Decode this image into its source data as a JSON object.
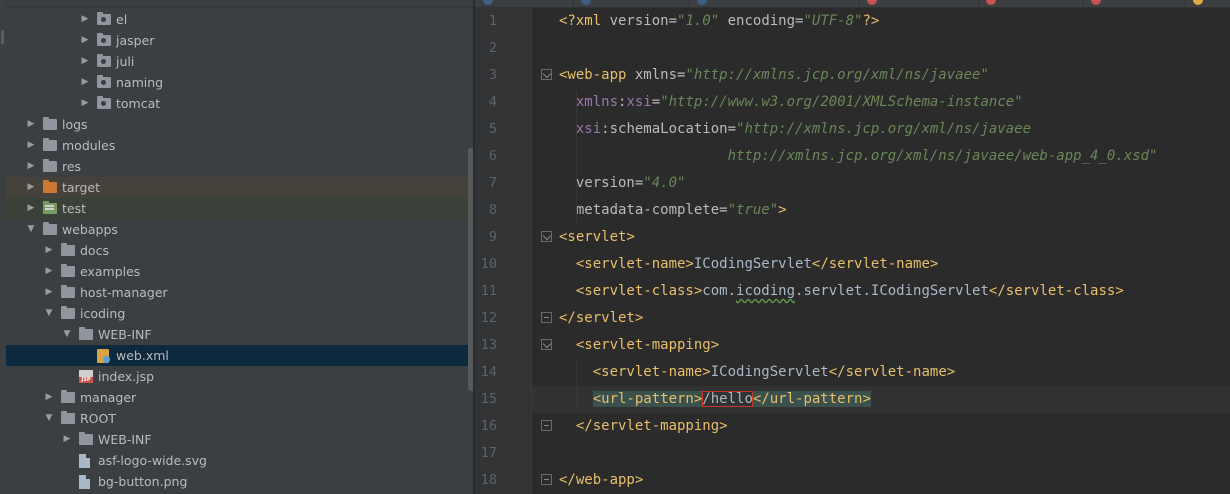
{
  "tree": {
    "items": [
      {
        "label": "el",
        "depth": 4,
        "icon": "package-folder-icon",
        "arrow": "right"
      },
      {
        "label": "jasper",
        "depth": 4,
        "icon": "package-folder-icon",
        "arrow": "right"
      },
      {
        "label": "juli",
        "depth": 4,
        "icon": "package-folder-icon",
        "arrow": "right"
      },
      {
        "label": "naming",
        "depth": 4,
        "icon": "package-folder-icon",
        "arrow": "right"
      },
      {
        "label": "tomcat",
        "depth": 4,
        "icon": "package-folder-icon",
        "arrow": "right"
      },
      {
        "label": "logs",
        "depth": 1,
        "icon": "folder-icon",
        "arrow": "right"
      },
      {
        "label": "modules",
        "depth": 1,
        "icon": "folder-icon",
        "arrow": "right"
      },
      {
        "label": "res",
        "depth": 1,
        "icon": "folder-icon",
        "arrow": "right"
      },
      {
        "label": "target",
        "depth": 1,
        "icon": "excluded-folder-icon",
        "arrow": "right",
        "state": "target"
      },
      {
        "label": "test",
        "depth": 1,
        "icon": "test-folder-icon",
        "arrow": "right",
        "state": "test"
      },
      {
        "label": "webapps",
        "depth": 1,
        "icon": "folder-icon",
        "arrow": "down"
      },
      {
        "label": "docs",
        "depth": 2,
        "icon": "folder-icon",
        "arrow": "right"
      },
      {
        "label": "examples",
        "depth": 2,
        "icon": "folder-icon",
        "arrow": "right"
      },
      {
        "label": "host-manager",
        "depth": 2,
        "icon": "folder-icon",
        "arrow": "right"
      },
      {
        "label": "icoding",
        "depth": 2,
        "icon": "folder-icon",
        "arrow": "down"
      },
      {
        "label": "WEB-INF",
        "depth": 3,
        "icon": "folder-icon",
        "arrow": "down"
      },
      {
        "label": "web.xml",
        "depth": 4,
        "icon": "xml-file-icon",
        "arrow": "none",
        "state": "selected"
      },
      {
        "label": "index.jsp",
        "depth": 3,
        "icon": "jsp-file-icon",
        "arrow": "none"
      },
      {
        "label": "manager",
        "depth": 2,
        "icon": "folder-icon",
        "arrow": "right"
      },
      {
        "label": "ROOT",
        "depth": 2,
        "icon": "folder-icon",
        "arrow": "down"
      },
      {
        "label": "WEB-INF",
        "depth": 3,
        "icon": "folder-icon",
        "arrow": "right"
      },
      {
        "label": "asf-logo-wide.svg",
        "depth": 3,
        "icon": "svg-file-icon",
        "arrow": "none"
      },
      {
        "label": "bg-button.png",
        "depth": 3,
        "icon": "image-file-icon",
        "arrow": "none"
      }
    ]
  },
  "tabs": [
    {
      "dot": "#3d6185"
    },
    {
      "dot": "#3d6185"
    },
    {
      "dot": "#3d6185"
    },
    {
      "dot": "#c75450"
    },
    {
      "dot": "#c75450"
    },
    {
      "dot": "#c75450"
    },
    {
      "dot": "#e0a843"
    }
  ],
  "editor": {
    "current_line": 15,
    "lines": [
      {
        "n": "1",
        "segs": [
          [
            "tg",
            "<?xml "
          ],
          [
            "at",
            "version="
          ],
          [
            "va",
            "\"1.0\""
          ],
          [
            "at",
            " encoding="
          ],
          [
            "va",
            "\"UTF-8\""
          ],
          [
            "tg",
            "?>"
          ]
        ]
      },
      {
        "n": "2",
        "segs": []
      },
      {
        "n": "3",
        "fold": "start",
        "segs": [
          [
            "tg",
            "<web-app "
          ],
          [
            "at",
            "xmlns="
          ],
          [
            "va",
            "\"http://xmlns.jcp.org/xml/ns/javaee\""
          ]
        ]
      },
      {
        "n": "4",
        "segs": [
          [
            "at",
            "  "
          ],
          [
            "ns",
            "xmlns"
          ],
          [
            "at",
            ":"
          ],
          [
            "ns",
            "xsi"
          ],
          [
            "at",
            "="
          ],
          [
            "va",
            "\"http://www.w3.org/2001/XMLSchema-instance\""
          ]
        ]
      },
      {
        "n": "5",
        "segs": [
          [
            "at",
            "  "
          ],
          [
            "ns",
            "xsi"
          ],
          [
            "at",
            ":schemaLocation="
          ],
          [
            "va",
            "\"http://xmlns.jcp.org/xml/ns/javaee"
          ]
        ]
      },
      {
        "n": "6",
        "segs": [
          [
            "va",
            "                    http://xmlns.jcp.org/xml/ns/javaee/web-app_4_0.xsd\""
          ]
        ]
      },
      {
        "n": "7",
        "segs": [
          [
            "at",
            "  version="
          ],
          [
            "va",
            "\"4.0\""
          ]
        ]
      },
      {
        "n": "8",
        "segs": [
          [
            "at",
            "  metadata-complete="
          ],
          [
            "va",
            "\"true\""
          ],
          [
            "tg",
            ">"
          ]
        ]
      },
      {
        "n": "9",
        "fold": "start",
        "segs": [
          [
            "tg",
            "<servlet>"
          ]
        ]
      },
      {
        "n": "10",
        "segs": [
          [
            "at",
            "  "
          ],
          [
            "tg",
            "<servlet-name>"
          ],
          [
            "txt",
            "ICodingServlet"
          ],
          [
            "tg",
            "</servlet-name>"
          ]
        ]
      },
      {
        "n": "11",
        "segs": [
          [
            "at",
            "  "
          ],
          [
            "tg",
            "<servlet-class>"
          ],
          [
            "txt",
            "com."
          ],
          [
            "typo",
            "icoding"
          ],
          [
            "txt",
            ".servlet.ICodingServlet"
          ],
          [
            "tg",
            "</servlet-class>"
          ]
        ]
      },
      {
        "n": "12",
        "fold": "end",
        "segs": [
          [
            "tg",
            "</servlet>"
          ]
        ]
      },
      {
        "n": "13",
        "fold": "start",
        "segs": [
          [
            "at",
            "  "
          ],
          [
            "tg",
            "<servlet-mapping>"
          ]
        ]
      },
      {
        "n": "14",
        "segs": [
          [
            "at",
            "    "
          ],
          [
            "tg",
            "<servlet-name>"
          ],
          [
            "txt",
            "ICodingServlet"
          ],
          [
            "tg",
            "</servlet-name>"
          ]
        ]
      },
      {
        "n": "15",
        "segs": [
          [
            "at",
            "    "
          ],
          [
            "tghl",
            "<url-pattern>"
          ],
          [
            "caret",
            "/hello"
          ],
          [
            "tghl",
            "</url-pattern>"
          ]
        ]
      },
      {
        "n": "16",
        "fold": "end",
        "segs": [
          [
            "at",
            "  "
          ],
          [
            "tg",
            "</servlet-mapping>"
          ]
        ]
      },
      {
        "n": "17",
        "segs": []
      },
      {
        "n": "18",
        "fold": "end",
        "segs": [
          [
            "tg",
            "</web-app>"
          ]
        ]
      }
    ]
  }
}
